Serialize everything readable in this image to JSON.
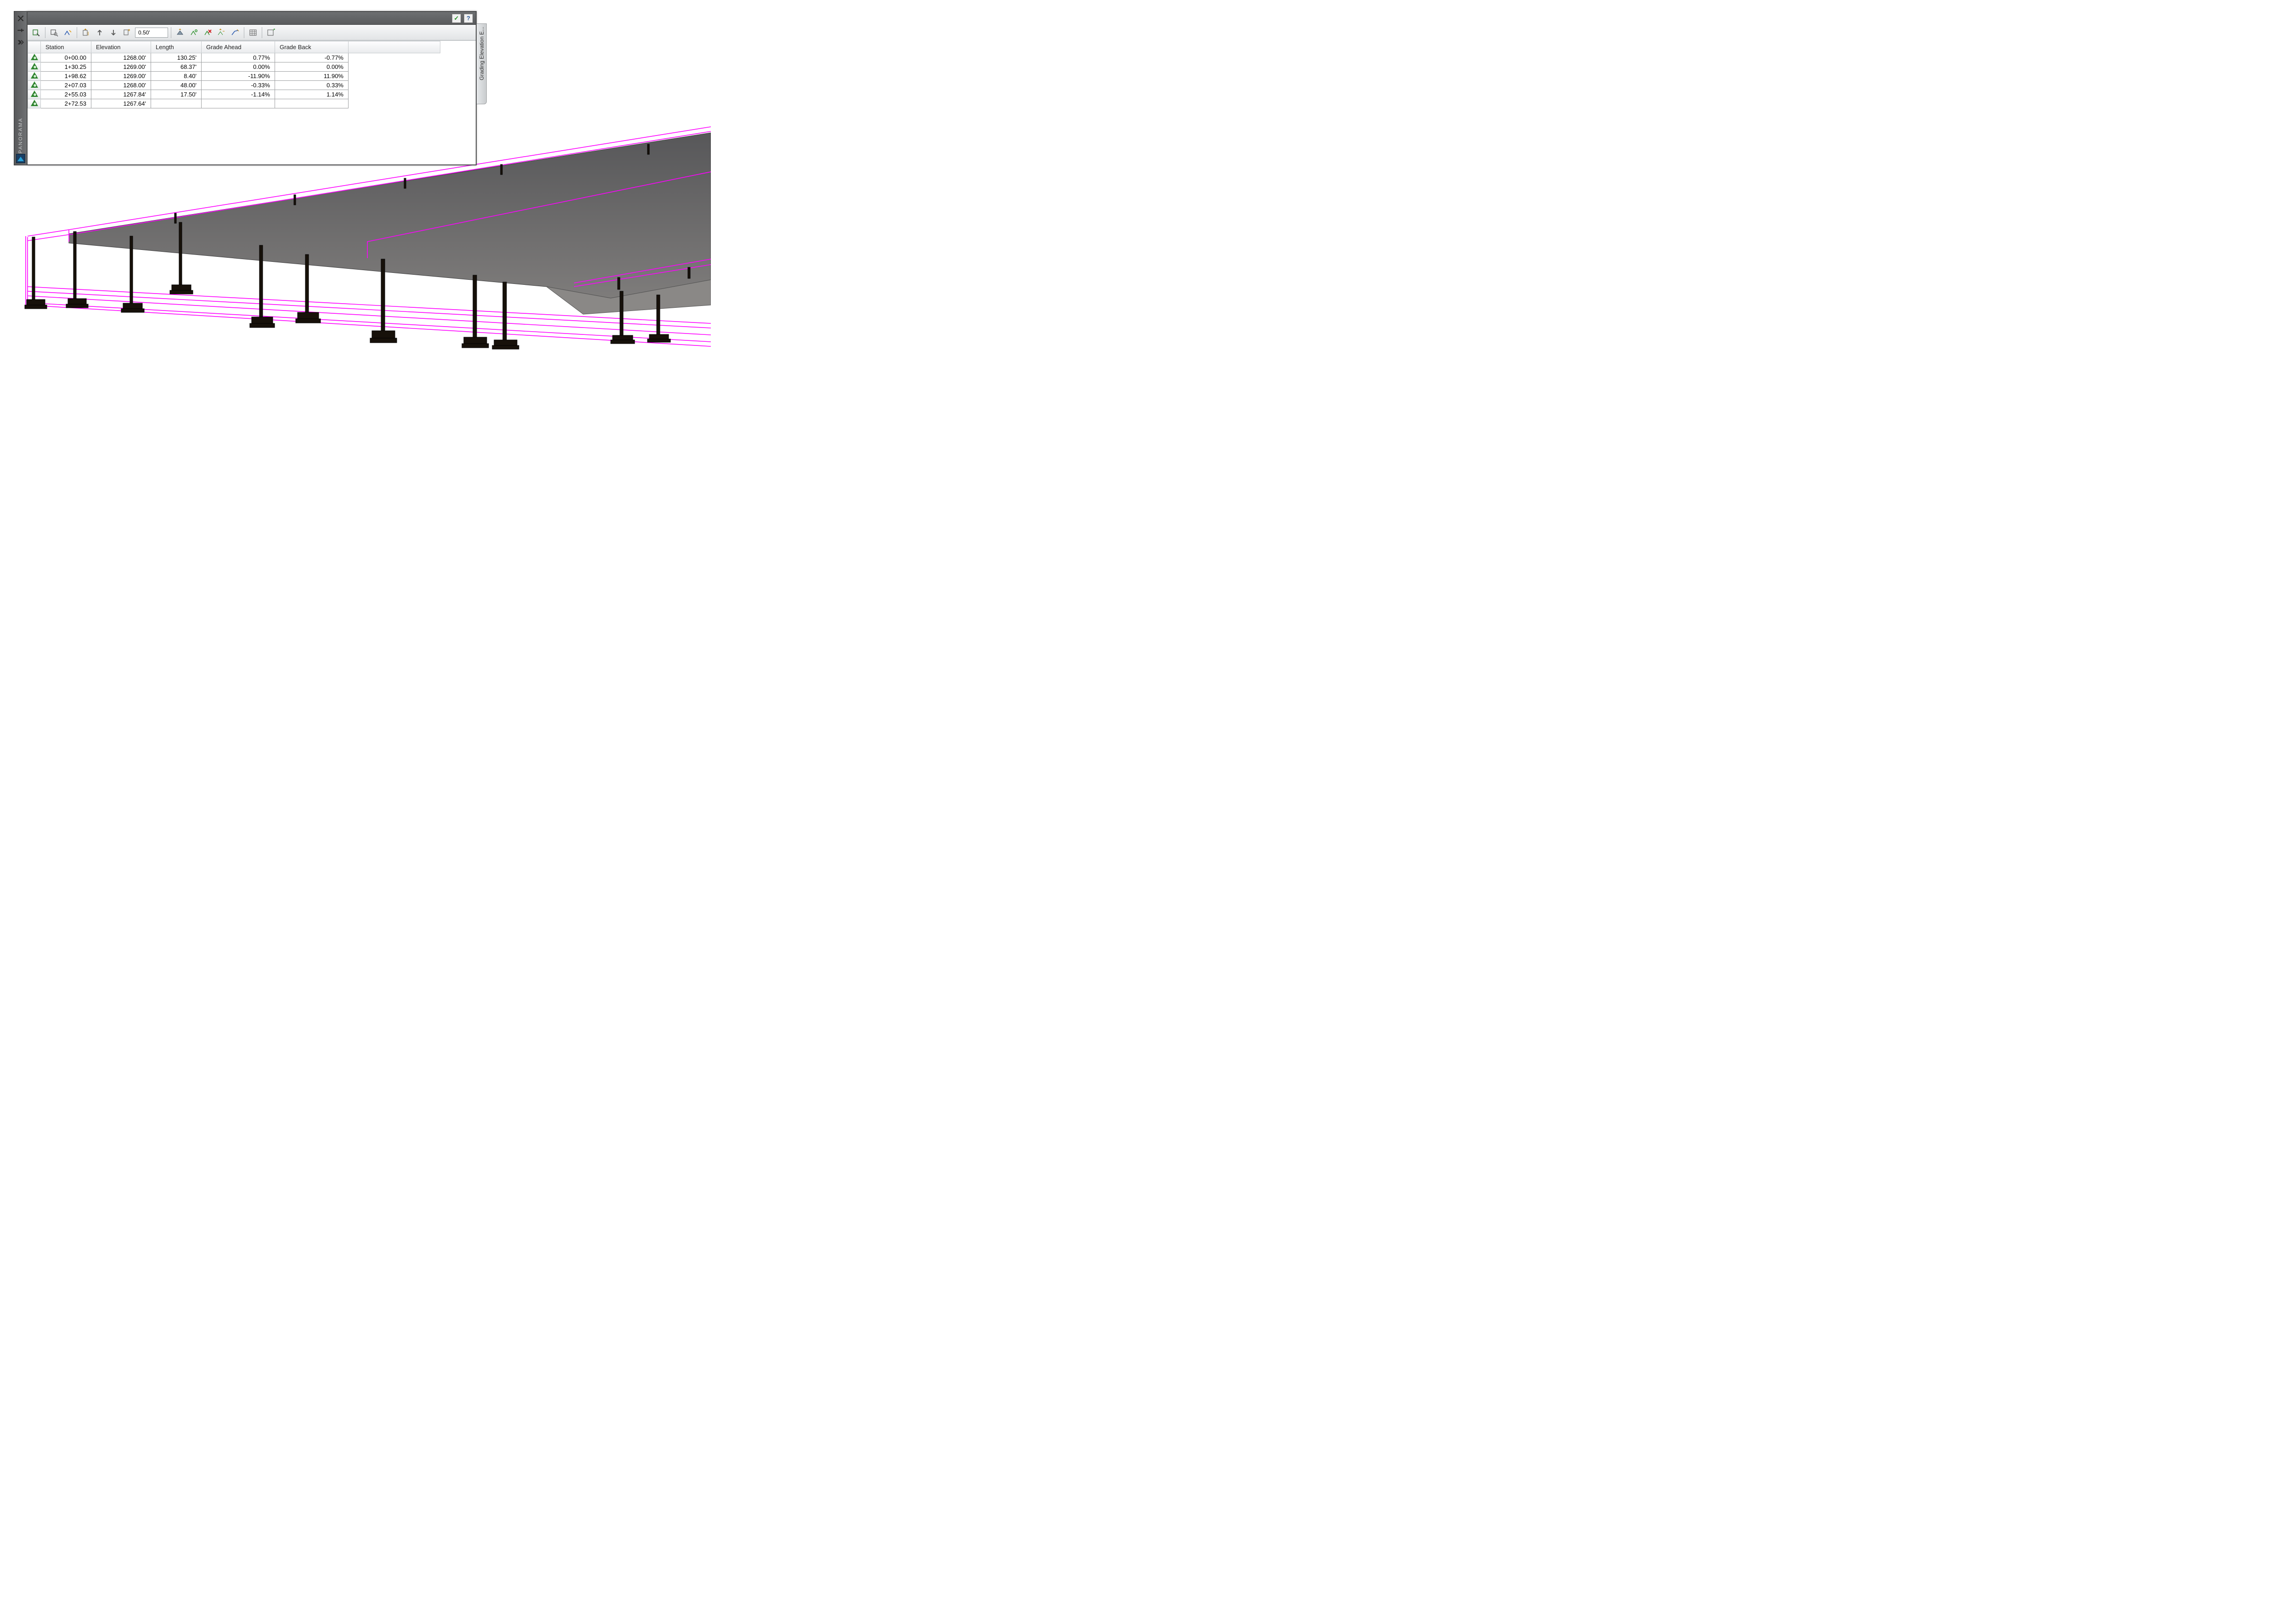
{
  "panel": {
    "rail_label": "PANORAMA",
    "side_tab_label": "Grading Elevation E..."
  },
  "toolbar": {
    "increment_value": "0.50'"
  },
  "columns": {
    "station": "Station",
    "elevation": "Elevation",
    "length": "Length",
    "grade_ahead": "Grade Ahead",
    "grade_back": "Grade Back"
  },
  "rows": [
    {
      "station": "0+00.00",
      "elevation": "1268.00'",
      "length": "130.25'",
      "grade_ahead": "0.77%",
      "grade_back": "-0.77%"
    },
    {
      "station": "1+30.25",
      "elevation": "1269.00'",
      "length": "68.37'",
      "grade_ahead": "0.00%",
      "grade_back": "0.00%"
    },
    {
      "station": "1+98.62",
      "elevation": "1269.00'",
      "length": "8.40'",
      "grade_ahead": "-11.90%",
      "grade_back": "11.90%"
    },
    {
      "station": "2+07.03",
      "elevation": "1268.00'",
      "length": "48.00'",
      "grade_ahead": "-0.33%",
      "grade_back": "0.33%"
    },
    {
      "station": "2+55.03",
      "elevation": "1267.84'",
      "length": "17.50'",
      "grade_ahead": "-1.14%",
      "grade_back": "1.14%"
    },
    {
      "station": "2+72.53",
      "elevation": "1267.64'",
      "length": "",
      "grade_ahead": "",
      "grade_back": ""
    }
  ],
  "col_widths": {
    "station": 110,
    "elevation": 130,
    "length": 110,
    "grade_ahead": 160,
    "grade_back": 160
  },
  "colors": {
    "wire": "#ff00ff",
    "surface_top": "#5b5c5e",
    "surface_bot": "#817f7e",
    "post": "#1a1307"
  }
}
